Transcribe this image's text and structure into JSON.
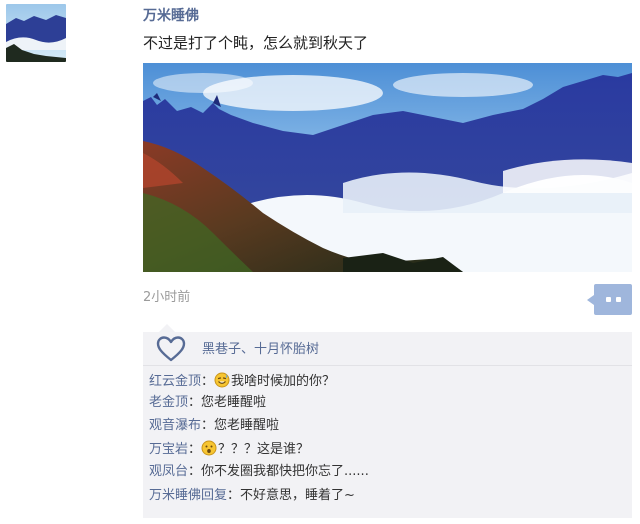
{
  "post": {
    "username": "万米睡佛",
    "text": "不过是打了个盹，怎么就到秋天了",
    "timestamp": "2小时前",
    "avatar_icon": "mountain-avatar",
    "photo_subject": "mountains-above-clouds"
  },
  "likes": {
    "icon": "heart-icon",
    "names": "黑巷子、十月怀胎树"
  },
  "comments": [
    {
      "author": "红云金顶",
      "separator": "：",
      "emoji": "sweat-smile-emoji",
      "text": "我啥时候加的你？"
    },
    {
      "author": "老金顶",
      "separator": "：",
      "emoji": "",
      "text": "您老睡醒啦"
    },
    {
      "author": "观音瀑布",
      "separator": "：",
      "emoji": "",
      "text": "您老睡醒啦"
    },
    {
      "author": "万宝岩",
      "separator": "：",
      "emoji": "surprised-emoji",
      "text": "？？？这是谁？"
    },
    {
      "author": "观凤台",
      "separator": "：",
      "emoji": "",
      "text": "你不发圈我都快把你忘了......"
    },
    {
      "author": "万米睡佛回复",
      "separator": "：",
      "emoji": "",
      "text": "不好意思，睡着了~"
    }
  ],
  "colors": {
    "name_link": "#576b95",
    "comment_bg": "#f2f2f5",
    "action_button": "#9fb6dc",
    "timestamp": "#9b9b9b"
  }
}
